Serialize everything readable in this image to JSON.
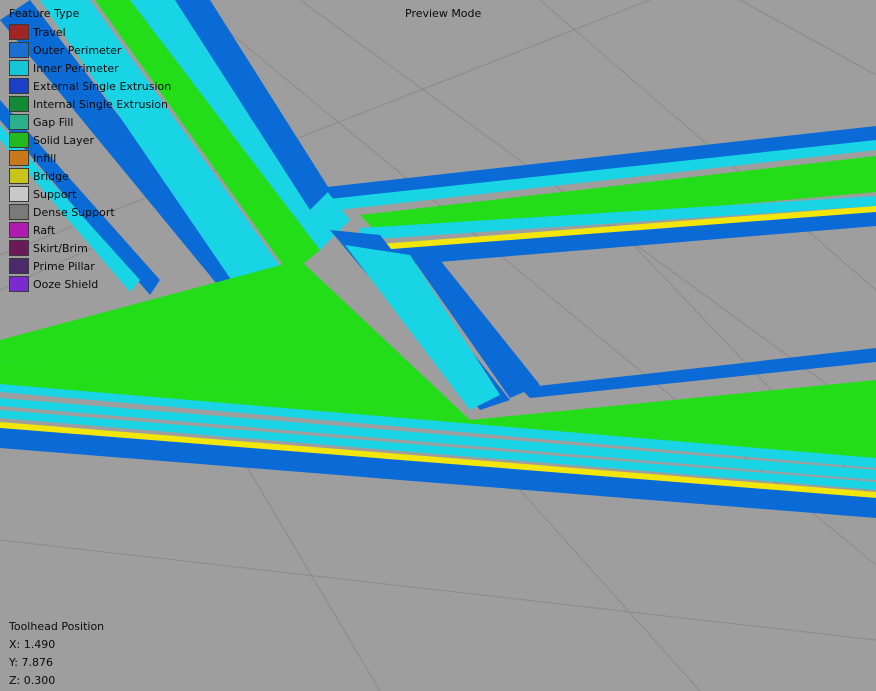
{
  "header": {
    "mode_label": "Preview Mode"
  },
  "legend": {
    "title": "Feature Type",
    "items": [
      {
        "label": "Travel",
        "color": "#a02626"
      },
      {
        "label": "Outer Perimeter",
        "color": "#1a6fd0"
      },
      {
        "label": "Inner Perimeter",
        "color": "#14c6d6"
      },
      {
        "label": "External Single Extrusion",
        "color": "#1a40c8"
      },
      {
        "label": "Internal Single Extrusion",
        "color": "#138a36"
      },
      {
        "label": "Gap Fill",
        "color": "#2ab08a"
      },
      {
        "label": "Solid Layer",
        "color": "#22b81e"
      },
      {
        "label": "Infill",
        "color": "#c87a1a"
      },
      {
        "label": "Bridge",
        "color": "#c8c41a"
      },
      {
        "label": "Support",
        "color": "#c8c8c8"
      },
      {
        "label": "Dense Support",
        "color": "#7a7a7a"
      },
      {
        "label": "Raft",
        "color": "#b01ab0"
      },
      {
        "label": "Skirt/Brim",
        "color": "#6a1a5a"
      },
      {
        "label": "Prime Pillar",
        "color": "#4a2a6a"
      },
      {
        "label": "Ooze Shield",
        "color": "#7a2ad0"
      }
    ]
  },
  "toolhead": {
    "title": "Toolhead Position",
    "x": "X: 1.490",
    "y": "Y: 7.876",
    "z": "Z: 0.300"
  },
  "scene": {
    "background": "#9e9e9e",
    "grid_color": "#8a8a8a",
    "outer_perimeter": "#0a6ad6",
    "inner_perimeter": "#18d4e4",
    "solid_layer": "#22dd18",
    "bridge": "#f2e60a"
  }
}
